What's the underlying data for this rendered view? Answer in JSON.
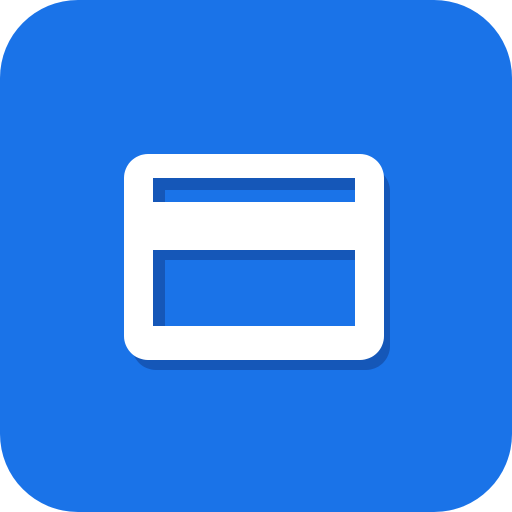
{
  "app_icon": {
    "icon": "credit-card-icon",
    "background_color": "#1A73E8",
    "glyph_color": "#FFFFFF",
    "shadow_color": "#1557B8"
  }
}
